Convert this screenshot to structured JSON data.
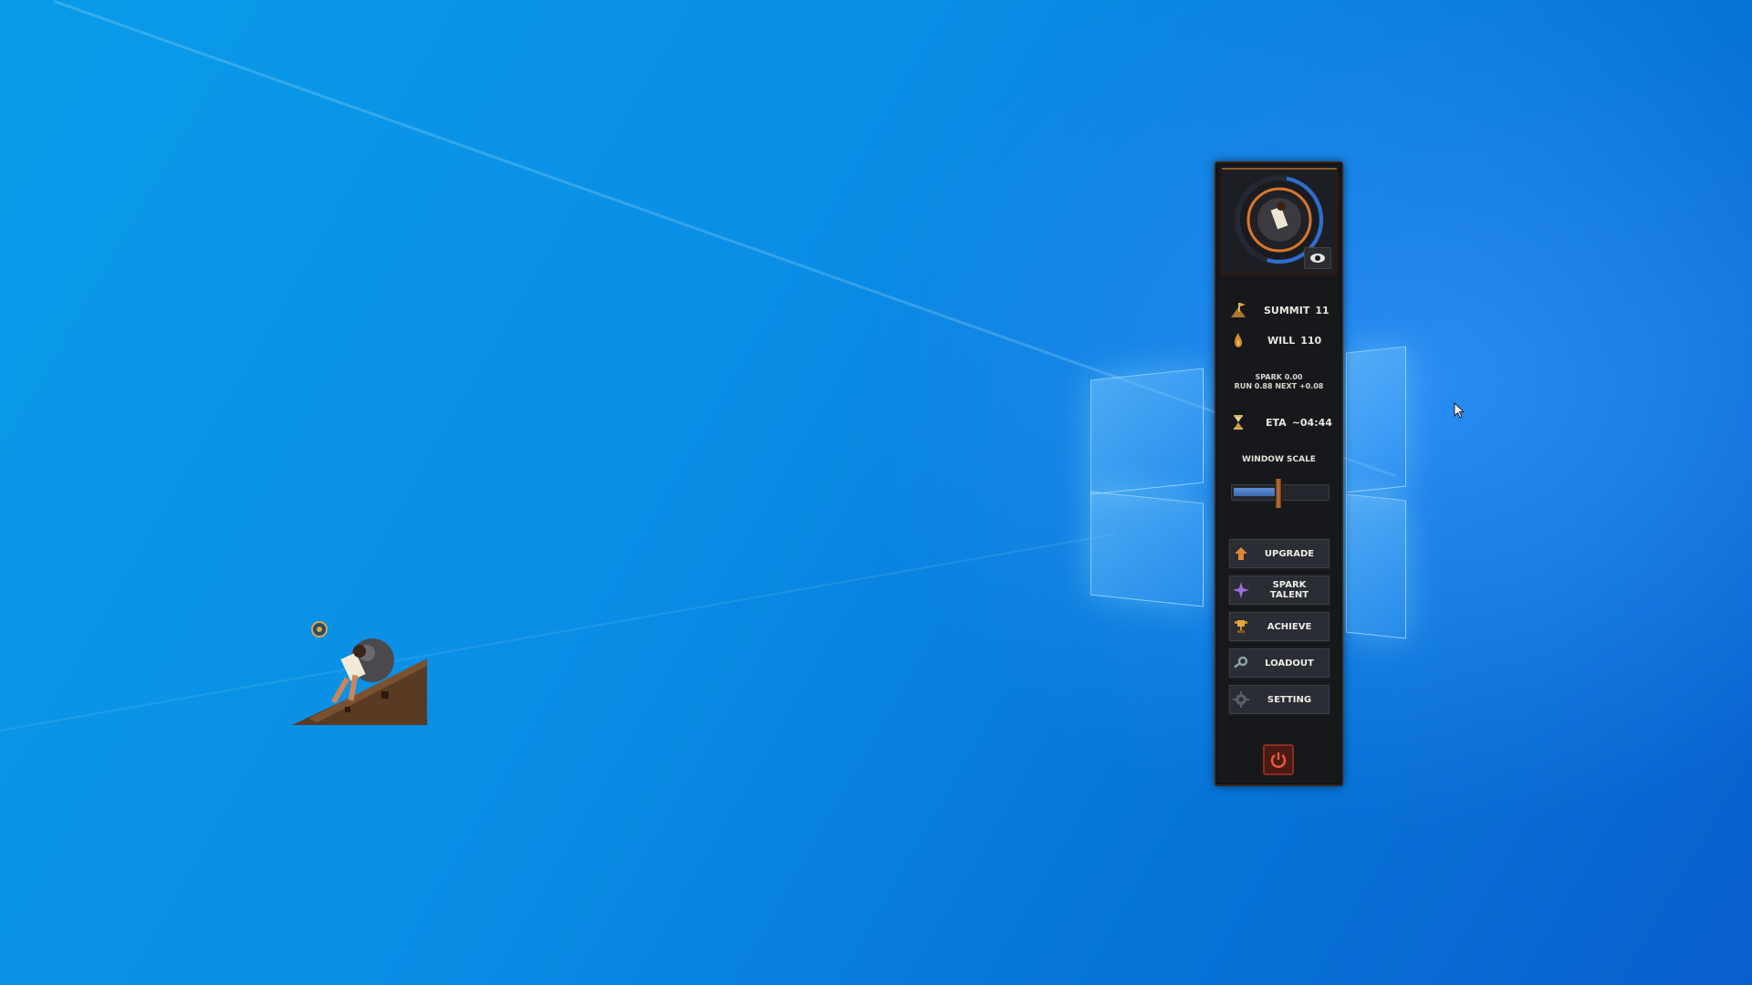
{
  "panel": {
    "stats": {
      "summit": {
        "label": "SUMMIT",
        "value": "11"
      },
      "will": {
        "label": "WILL",
        "value": "110"
      },
      "spark_line": "SPARK  0.00",
      "run_line": "RUN  0.88  NEXT +0.08",
      "eta": {
        "label": "ETA",
        "value": "~04:44"
      }
    },
    "window_scale": {
      "label": "WINDOW SCALE",
      "fraction": 0.46
    },
    "buttons": [
      {
        "label": "UPGRADE",
        "icon": "upgrade-arrow-icon"
      },
      {
        "label": "SPARK TALENT",
        "icon": "spark-star-icon"
      },
      {
        "label": "ACHIEVE",
        "icon": "trophy-icon"
      },
      {
        "label": "LOADOUT",
        "icon": "key-icon"
      },
      {
        "label": "SETTING",
        "icon": "gear-icon"
      }
    ],
    "colors": {
      "accent": "#c8743a",
      "slider": "#4a7cc4",
      "power": "#c0392b",
      "panel": "#17181c"
    }
  }
}
